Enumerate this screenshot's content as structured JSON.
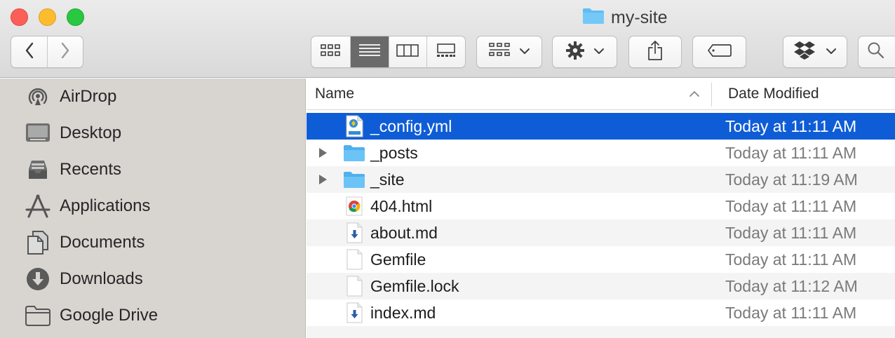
{
  "window": {
    "title": "my-site",
    "title_icon": "folder-icon"
  },
  "toolbar": {
    "back_icon": "chevron-left-icon",
    "forward_icon": "chevron-right-icon",
    "view_modes": [
      "icon-view",
      "list-view",
      "column-view",
      "gallery-view"
    ],
    "active_view": "list-view",
    "group_icon": "group-by-icon",
    "action_icon": "gear-icon",
    "share_icon": "share-icon",
    "tag_icon": "tag-icon",
    "dropbox_icon": "dropbox-icon",
    "search_icon": "search-icon"
  },
  "sidebar": {
    "items": [
      {
        "label": "AirDrop",
        "icon": "airdrop-icon"
      },
      {
        "label": "Desktop",
        "icon": "desktop-icon"
      },
      {
        "label": "Recents",
        "icon": "recents-icon"
      },
      {
        "label": "Applications",
        "icon": "applications-icon"
      },
      {
        "label": "Documents",
        "icon": "documents-icon"
      },
      {
        "label": "Downloads",
        "icon": "downloads-icon"
      },
      {
        "label": "Google Drive",
        "icon": "folder-icon"
      }
    ]
  },
  "columns": {
    "name": "Name",
    "date_modified": "Date Modified"
  },
  "files": [
    {
      "name": "_config.yml",
      "date": "Today at 11:11 AM",
      "icon": "yaml-file-icon",
      "selected": true,
      "folder": false
    },
    {
      "name": "_posts",
      "date": "Today at 11:11 AM",
      "icon": "folder-icon",
      "selected": false,
      "folder": true
    },
    {
      "name": "_site",
      "date": "Today at 11:19 AM",
      "icon": "folder-icon",
      "selected": false,
      "folder": true
    },
    {
      "name": "404.html",
      "date": "Today at 11:11 AM",
      "icon": "chrome-html-icon",
      "selected": false,
      "folder": false
    },
    {
      "name": "about.md",
      "date": "Today at 11:11 AM",
      "icon": "markdown-file-icon",
      "selected": false,
      "folder": false
    },
    {
      "name": "Gemfile",
      "date": "Today at 11:11 AM",
      "icon": "blank-file-icon",
      "selected": false,
      "folder": false
    },
    {
      "name": "Gemfile.lock",
      "date": "Today at 11:12 AM",
      "icon": "blank-file-icon",
      "selected": false,
      "folder": false
    },
    {
      "name": "index.md",
      "date": "Today at 11:11 AM",
      "icon": "markdown-file-icon",
      "selected": false,
      "folder": false
    }
  ],
  "colors": {
    "selection": "#0f5dd6",
    "sidebar_bg": "#d8d4d0",
    "folder_blue": "#5fbcf4"
  }
}
